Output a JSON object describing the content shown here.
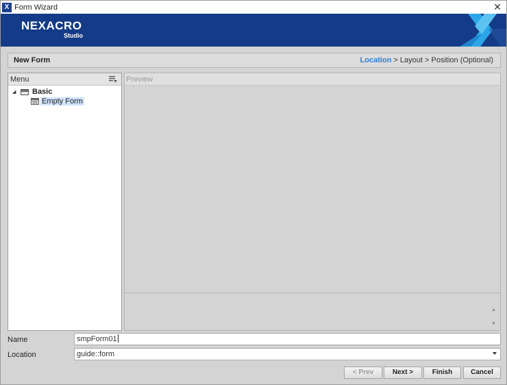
{
  "window": {
    "title": "Form Wizard",
    "close_glyph": "✕",
    "app_icon": "nexacro-x-icon"
  },
  "banner": {
    "logo_main": "NEXACRO",
    "logo_sub": "Studio",
    "brand_color": "#143b87",
    "accent_color": "#2aa6e8"
  },
  "stepbar": {
    "title": "New Form",
    "steps": [
      {
        "label": "Location",
        "active": true
      },
      {
        "label": "Layout",
        "active": false
      },
      {
        "label": "Position (Optional)",
        "active": false
      }
    ],
    "separator": " > "
  },
  "menu": {
    "header": "Menu",
    "sort_icon": "sort-list-icon",
    "tree": {
      "toggle_glyph": "◢",
      "group_label": "Basic",
      "items": [
        {
          "label": "Empty Form",
          "selected": true
        }
      ]
    }
  },
  "preview": {
    "header": "Preview",
    "scroll_up": "▲",
    "scroll_down": "▼"
  },
  "form": {
    "name_label": "Name",
    "name_value": "smpForm01",
    "location_label": "Location",
    "location_value": "guide::form"
  },
  "buttons": {
    "prev": "< Prev",
    "next": "Next >",
    "finish": "Finish",
    "cancel": "Cancel"
  }
}
